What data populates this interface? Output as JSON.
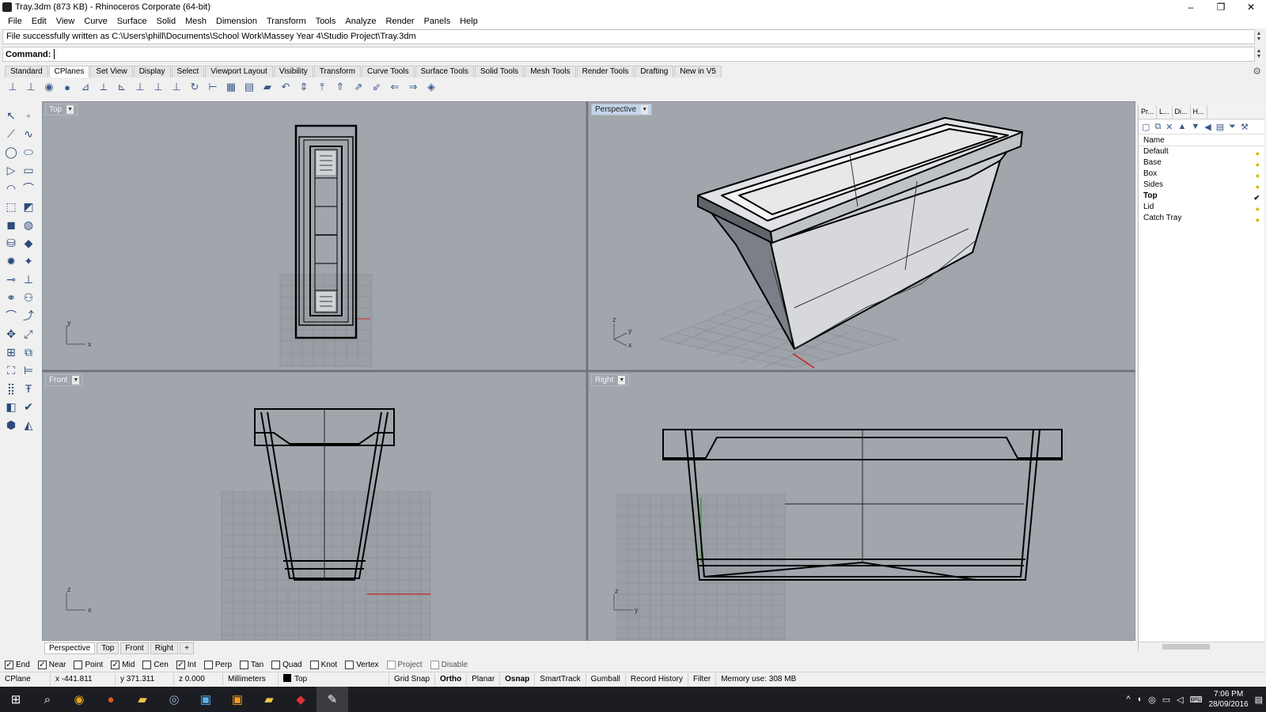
{
  "window": {
    "title": "Tray.3dm (873 KB) - Rhinoceros Corporate (64-bit)",
    "minimize": "–",
    "restore": "❐",
    "close": "✕"
  },
  "menu": [
    "File",
    "Edit",
    "View",
    "Curve",
    "Surface",
    "Solid",
    "Mesh",
    "Dimension",
    "Transform",
    "Tools",
    "Analyze",
    "Render",
    "Panels",
    "Help"
  ],
  "history": {
    "text": "File successfully written as C:\\Users\\phill\\Documents\\School Work\\Massey Year 4\\Studio Project\\Tray.3dm"
  },
  "command": {
    "label": "Command:",
    "value": ""
  },
  "toolbar_tabs": [
    "Standard",
    "CPlanes",
    "Set View",
    "Display",
    "Select",
    "Viewport Layout",
    "Visibility",
    "Transform",
    "Curve Tools",
    "Surface Tools",
    "Solid Tools",
    "Mesh Tools",
    "Render Tools",
    "Drafting",
    "New in V5"
  ],
  "active_toolbar_tab": "CPlanes",
  "viewports": {
    "top": {
      "label": "Top"
    },
    "perspective": {
      "label": "Perspective"
    },
    "front": {
      "label": "Front"
    },
    "right": {
      "label": "Right"
    }
  },
  "viewport_tabs": [
    "Perspective",
    "Top",
    "Front",
    "Right",
    "+"
  ],
  "panel": {
    "tabs": [
      "Pr...",
      "L...",
      "Di...",
      "H..."
    ],
    "header": "Name",
    "layers": [
      {
        "name": "Default",
        "current": false
      },
      {
        "name": "Base",
        "current": false
      },
      {
        "name": "Box",
        "current": false
      },
      {
        "name": "Sides",
        "current": false
      },
      {
        "name": "Top",
        "current": true
      },
      {
        "name": "Lid",
        "current": false
      },
      {
        "name": "Catch Tray",
        "current": false
      }
    ],
    "check": "✔",
    "bulb": "●"
  },
  "osnaps": [
    {
      "label": "End",
      "checked": true
    },
    {
      "label": "Near",
      "checked": true
    },
    {
      "label": "Point",
      "checked": false
    },
    {
      "label": "Mid",
      "checked": true
    },
    {
      "label": "Cen",
      "checked": false
    },
    {
      "label": "Int",
      "checked": true
    },
    {
      "label": "Perp",
      "checked": false
    },
    {
      "label": "Tan",
      "checked": false
    },
    {
      "label": "Quad",
      "checked": false
    },
    {
      "label": "Knot",
      "checked": false
    },
    {
      "label": "Vertex",
      "checked": false
    },
    {
      "label": "Project",
      "checked": false
    },
    {
      "label": "Disable",
      "checked": false
    }
  ],
  "status": {
    "cplane": "CPlane",
    "x": "x -441.811",
    "y": "y 371.311",
    "z": "z 0.000",
    "units": "Millimeters",
    "layer": "Top",
    "grid_snap": "Grid Snap",
    "ortho": "Ortho",
    "planar": "Planar",
    "osnap": "Osnap",
    "smarttrack": "SmartTrack",
    "gumball": "Gumball",
    "record_history": "Record History",
    "filter": "Filter",
    "memory": "Memory use: 308 MB"
  },
  "taskbar": {
    "time": "7:06 PM",
    "date": "28/09/2016"
  }
}
